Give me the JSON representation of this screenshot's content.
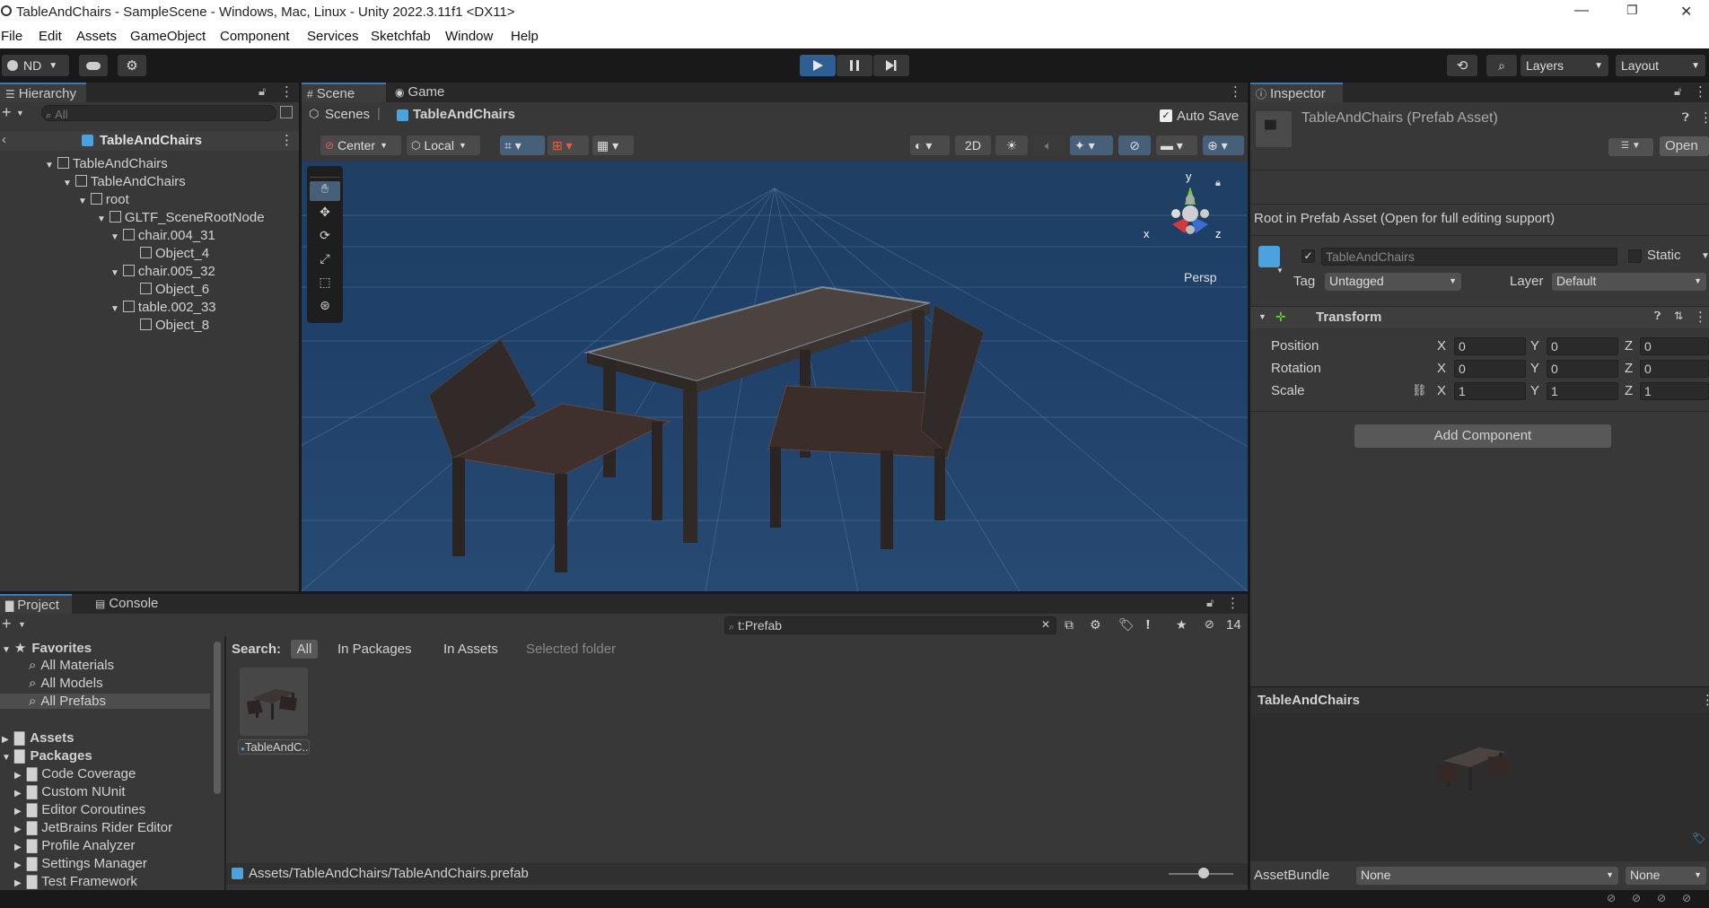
{
  "window": {
    "title": "TableAndChairs - SampleScene - Windows, Mac, Linux - Unity 2022.3.11f1 <DX11>",
    "minimize_glyph": "—",
    "restore_glyph": "❐",
    "close_glyph": "✕"
  },
  "menu": [
    "File",
    "Edit",
    "Assets",
    "GameObject",
    "Component",
    "Services",
    "Sketchfab",
    "Window",
    "Help"
  ],
  "toolbar": {
    "account": "ND",
    "layers": "Layers",
    "layout": "Layout"
  },
  "hierarchy": {
    "tab": "Hierarchy",
    "search_placeholder": "All",
    "prefab_header": "TableAndChairs",
    "items": [
      {
        "label": "TableAndChairs"
      },
      {
        "label": "TableAndChairs"
      },
      {
        "label": "root"
      },
      {
        "label": "GLTF_SceneRootNode"
      },
      {
        "label": "chair.004_31"
      },
      {
        "label": "Object_4"
      },
      {
        "label": "chair.005_32"
      },
      {
        "label": "Object_6"
      },
      {
        "label": "table.002_33"
      },
      {
        "label": "Object_8"
      }
    ]
  },
  "scene": {
    "tab_scene": "Scene",
    "tab_game": "Game",
    "breadcrumb_root": "Scenes",
    "breadcrumb_current": "TableAndChairs",
    "auto_save": "Auto Save",
    "pivot": "Center",
    "space": "Local",
    "mode_2d": "2D",
    "gizmo_y": "y",
    "gizmo_x": "x",
    "gizmo_z": "z",
    "persp": "Persp"
  },
  "inspector": {
    "tab": "Inspector",
    "title": "TableAndChairs (Prefab Asset)",
    "open_button": "Open",
    "root_note": "Root in Prefab Asset (Open for full editing support)",
    "object_name": "TableAndChairs",
    "static_label": "Static",
    "tag_label": "Tag",
    "tag_value": "Untagged",
    "layer_label": "Layer",
    "layer_value": "Default",
    "transform_title": "Transform",
    "position_label": "Position",
    "rotation_label": "Rotation",
    "scale_label": "Scale",
    "axis_x": "X",
    "axis_y": "Y",
    "axis_z": "Z",
    "position": {
      "x": "0",
      "y": "0",
      "z": "0"
    },
    "rotation": {
      "x": "0",
      "y": "0",
      "z": "0"
    },
    "scale": {
      "x": "1",
      "y": "1",
      "z": "1"
    },
    "add_component": "Add Component",
    "preview_title": "TableAndChairs",
    "assetbundle_label": "AssetBundle",
    "assetbundle_value": "None",
    "assetbundle_variant": "None"
  },
  "project": {
    "tab_project": "Project",
    "tab_console": "Console",
    "search_value": "t:Prefab",
    "hidden_count": "14",
    "search_label": "Search:",
    "scope_all": "All",
    "scope_packages": "In Packages",
    "scope_assets": "In Assets",
    "scope_selected": "Selected folder",
    "favorites_label": "Favorites",
    "favorites": [
      "All Materials",
      "All Models",
      "All Prefabs"
    ],
    "assets_label": "Assets",
    "packages_label": "Packages",
    "packages": [
      "Code Coverage",
      "Custom NUnit",
      "Editor Coroutines",
      "JetBrains Rider Editor",
      "Profile Analyzer",
      "Settings Manager",
      "Test Framework"
    ],
    "asset_tile_label": "TableAndC...",
    "footer_path": "Assets/TableAndChairs/TableAndChairs.prefab"
  },
  "colors": {
    "accent": "#3a79bb",
    "panel": "#383838",
    "dark": "#191919",
    "scene_sky": "#1f3f63"
  }
}
